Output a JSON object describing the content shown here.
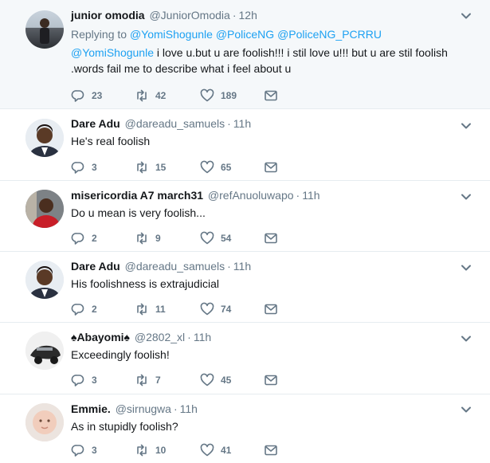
{
  "tweets": [
    {
      "name": "junior omodia",
      "handle": "@JuniorOmodia",
      "time": "12h",
      "replying_label": "Replying to",
      "replying_to": [
        "@YomiShogunle",
        "@PoliceNG",
        "@PoliceNG_PCRRU"
      ],
      "mention": "@YomiShogunle",
      "text": " i love u.but u are foolish!!! i stil love  u!!!  but u are stil foolish .words fail me to describe what i feel about u",
      "replies": "23",
      "retweets": "42",
      "likes": "189"
    },
    {
      "name": "Dare Adu",
      "handle": "@dareadu_samuels",
      "time": "11h",
      "text": "He's real foolish",
      "replies": "3",
      "retweets": "15",
      "likes": "65"
    },
    {
      "name": "misericordia A7 march31",
      "handle": "@refAnuoluwapo",
      "time": "11h",
      "text": "Do u mean is very foolish...",
      "replies": "2",
      "retweets": "9",
      "likes": "54"
    },
    {
      "name": "Dare Adu",
      "handle": "@dareadu_samuels",
      "time": "11h",
      "text": "His foolishness is extrajudicial",
      "replies": "2",
      "retweets": "11",
      "likes": "74"
    },
    {
      "name": "♠Abayomi♠",
      "handle": "@2802_xl",
      "time": "11h",
      "text": "Exceedingly foolish!",
      "replies": "3",
      "retweets": "7",
      "likes": "45"
    },
    {
      "name": "Emmie.",
      "handle": "@sirnugwa",
      "time": "11h",
      "text": "As in stupidly foolish?",
      "replies": "3",
      "retweets": "10",
      "likes": "41"
    }
  ],
  "colors": {
    "accent": "#1da1f2",
    "muted": "#657786",
    "highlight_bg": "#f5f8fa",
    "divider": "#e6ecf0"
  },
  "icons": {
    "reply": "reply-icon",
    "retweet": "retweet-icon",
    "like": "heart-icon",
    "dm": "envelope-icon",
    "more": "chevron-down-icon"
  }
}
